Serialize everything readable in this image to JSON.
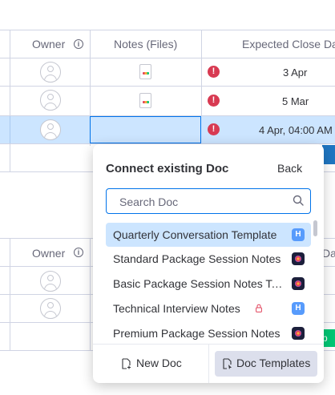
{
  "board": {
    "group1": {
      "columns": {
        "owner": "Owner",
        "notes": "Notes (Files)",
        "close_date": "Expected Close Da"
      },
      "rows": [
        {
          "date": "3 Apr",
          "has_file": true
        },
        {
          "date": "5 Mar",
          "has_file": true
        },
        {
          "date": "4 Apr, 04:00 AM",
          "has_file": false,
          "selected": true
        }
      ]
    },
    "group2": {
      "columns": {
        "owner": "Owner",
        "close_date": "Da"
      }
    },
    "green_label": "p"
  },
  "popup": {
    "title": "Connect existing Doc",
    "back": "Back",
    "search": {
      "placeholder": "Search Doc"
    },
    "docs": [
      {
        "label": "Quarterly Conversation Template",
        "icon": "H",
        "active": true
      },
      {
        "label": "Standard Package Session Notes",
        "icon": "image"
      },
      {
        "label": "Basic Package Session Notes Template",
        "icon": "image"
      },
      {
        "label": "Technical Interview Notes",
        "icon": "H",
        "locked": true
      },
      {
        "label": "Premium Package Session Notes",
        "icon": "image"
      }
    ],
    "footer": {
      "new_doc": "New Doc",
      "doc_templates": "Doc Templates"
    }
  },
  "colors": {
    "accent": "#0073ea",
    "selected_bg": "#cce5ff",
    "alert": "#d83a52"
  }
}
